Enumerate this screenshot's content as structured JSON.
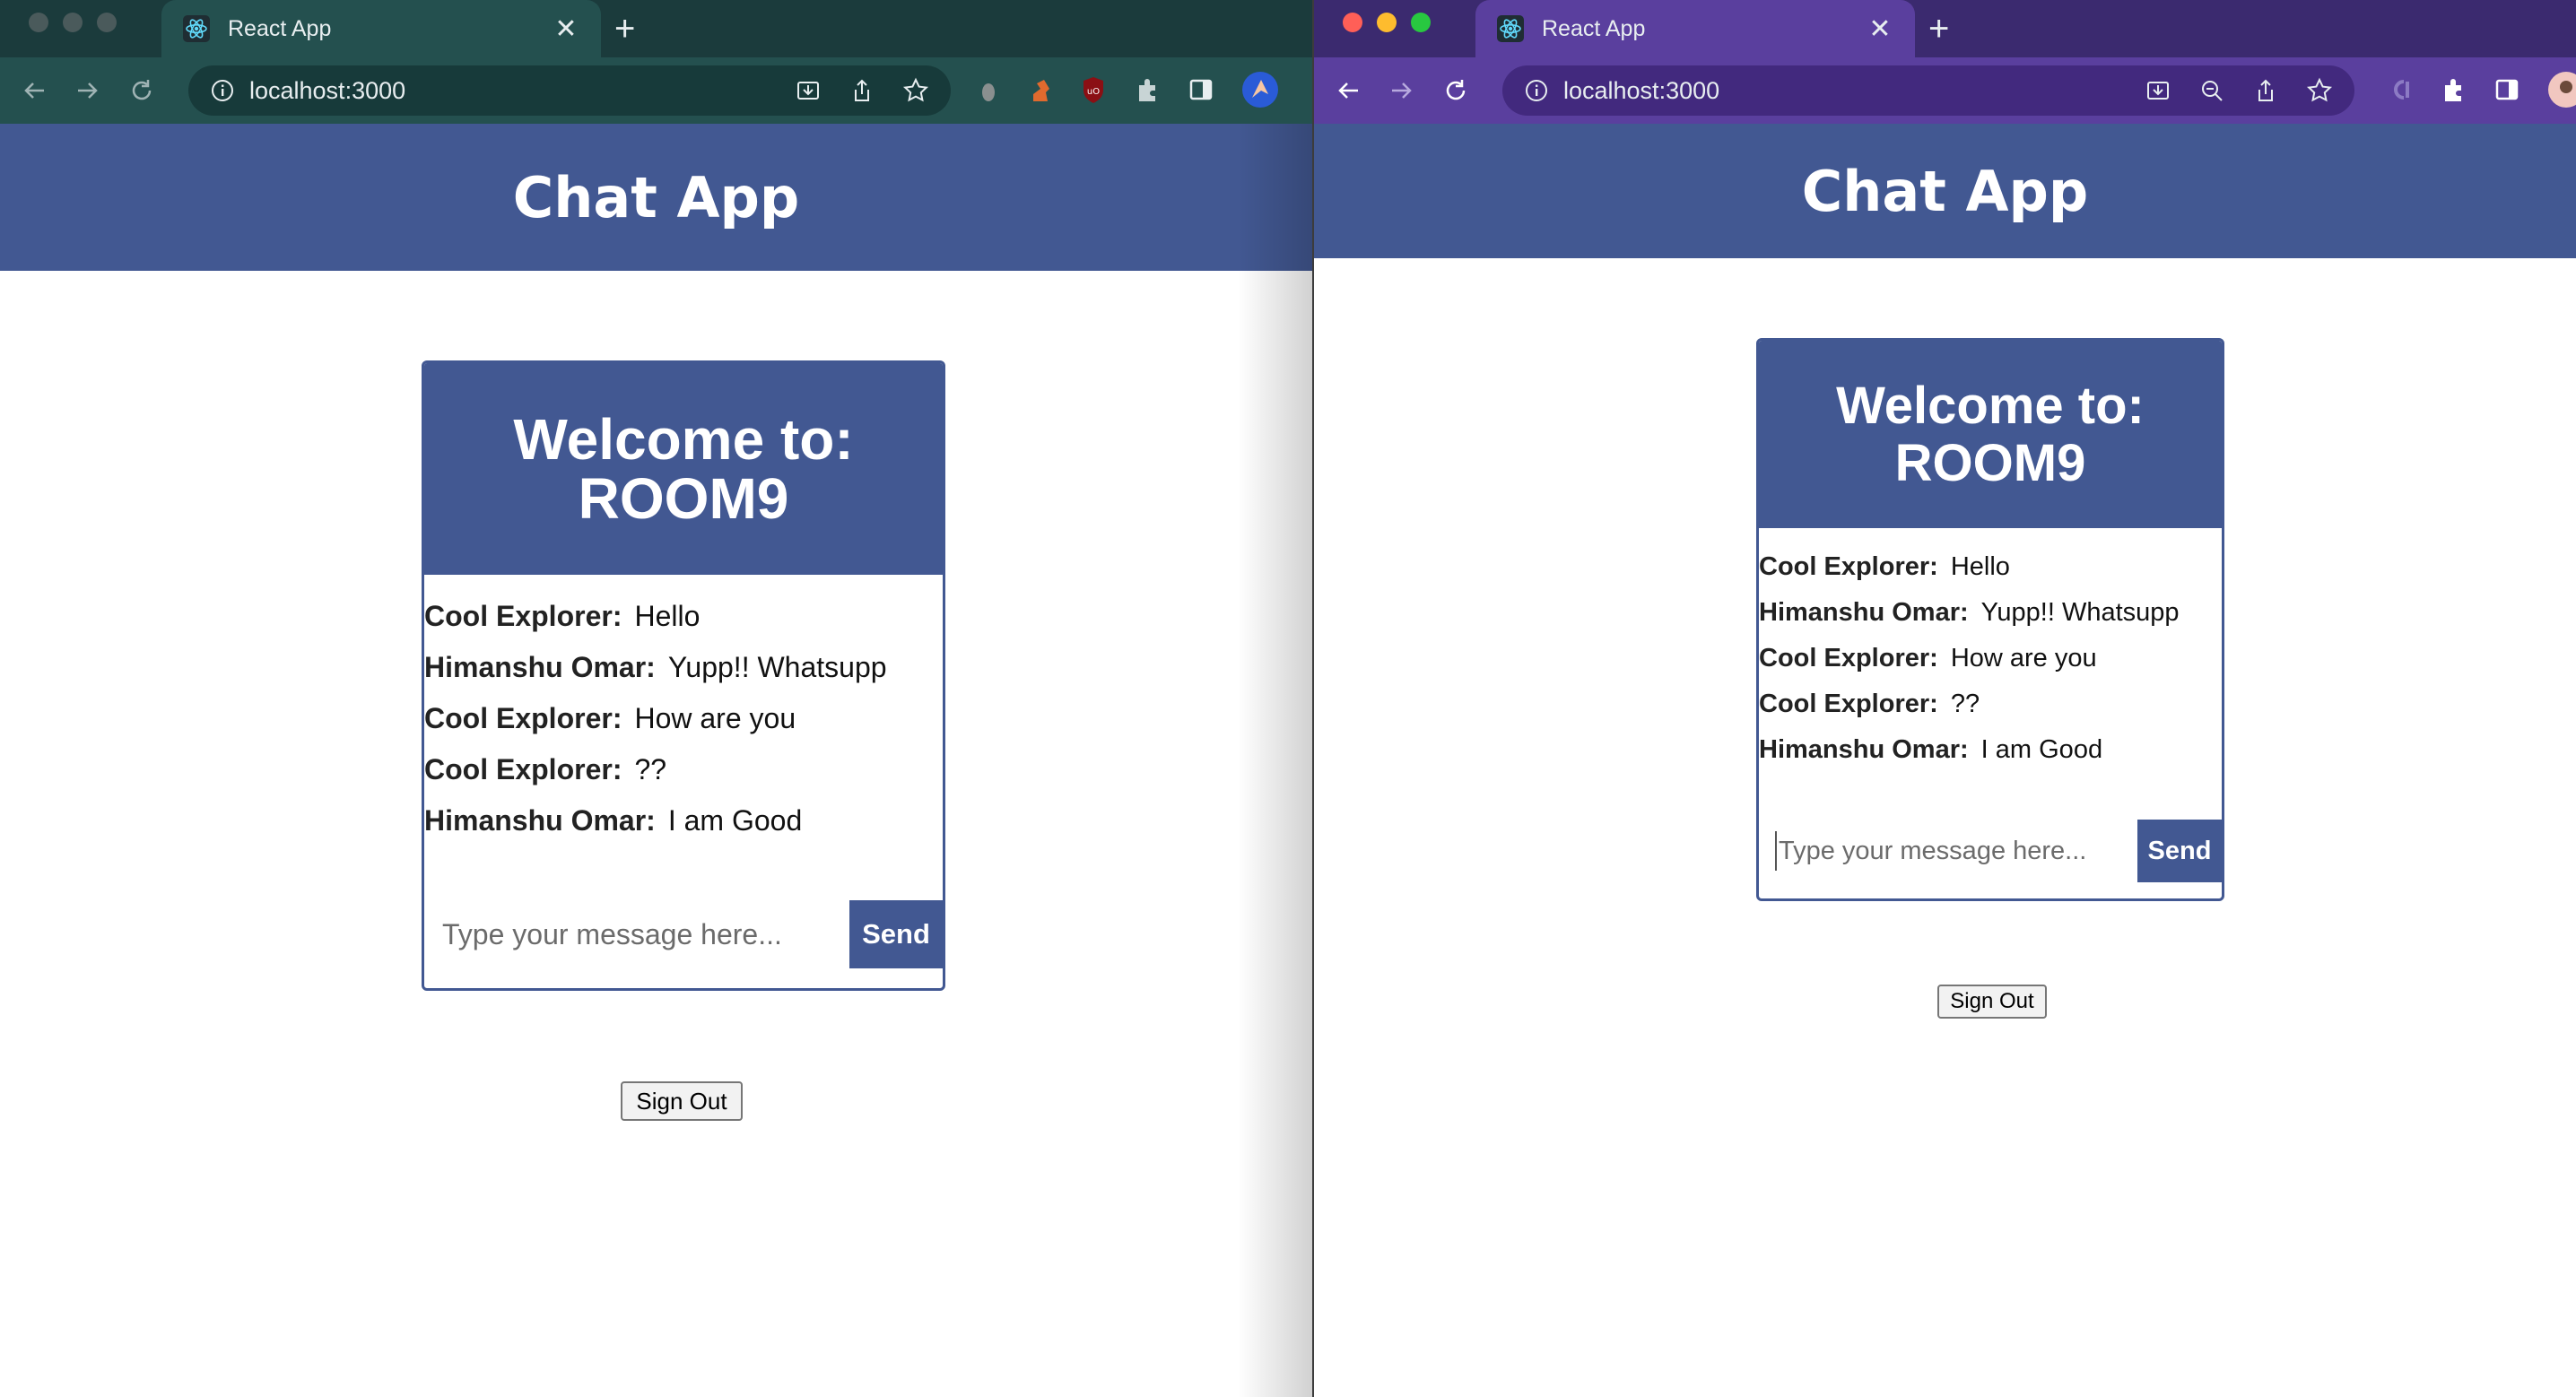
{
  "left_window": {
    "tab": {
      "title": "React App"
    },
    "address_bar": {
      "url": "localhost:3000"
    },
    "app": {
      "header_title": "Chat App",
      "room": {
        "welcome_line1": "Welcome to:",
        "welcome_line2": "ROOM9"
      },
      "messages": [
        {
          "author": "Cool Explorer:",
          "text": "Hello"
        },
        {
          "author": "Himanshu Omar:",
          "text": "Yupp!! Whatsupp"
        },
        {
          "author": "Cool Explorer:",
          "text": "How are you"
        },
        {
          "author": "Cool Explorer:",
          "text": "??"
        },
        {
          "author": "Himanshu Omar:",
          "text": "I am Good"
        }
      ],
      "composer": {
        "placeholder": "Type your message here...",
        "value": "",
        "send_label": "Send"
      },
      "signout_label": "Sign Out"
    }
  },
  "right_window": {
    "tab": {
      "title": "React App"
    },
    "address_bar": {
      "url": "localhost:3000"
    },
    "app": {
      "header_title": "Chat App",
      "room": {
        "welcome_line1": "Welcome to:",
        "welcome_line2": "ROOM9"
      },
      "messages": [
        {
          "author": "Cool Explorer:",
          "text": "Hello"
        },
        {
          "author": "Himanshu Omar:",
          "text": "Yupp!! Whatsupp"
        },
        {
          "author": "Cool Explorer:",
          "text": "How are you"
        },
        {
          "author": "Cool Explorer:",
          "text": "??"
        },
        {
          "author": "Himanshu Omar:",
          "text": "I am Good"
        }
      ],
      "composer": {
        "placeholder": "Type your message here...",
        "value": "",
        "send_label": "Send"
      },
      "signout_label": "Sign Out"
    }
  },
  "colors": {
    "brand": "#425892",
    "left_chrome": "#24504f",
    "right_chrome": "#5a3f9e",
    "traffic_red": "#ff5f57",
    "traffic_yellow": "#febc2e",
    "traffic_green": "#28c840"
  },
  "icons": [
    "react-favicon",
    "back-arrow-icon",
    "forward-arrow-icon",
    "reload-icon",
    "info-icon",
    "install-icon",
    "share-icon",
    "star-icon",
    "zoom-icon",
    "puzzle-extensions-icon",
    "sidepanel-icon",
    "profile-avatar"
  ]
}
